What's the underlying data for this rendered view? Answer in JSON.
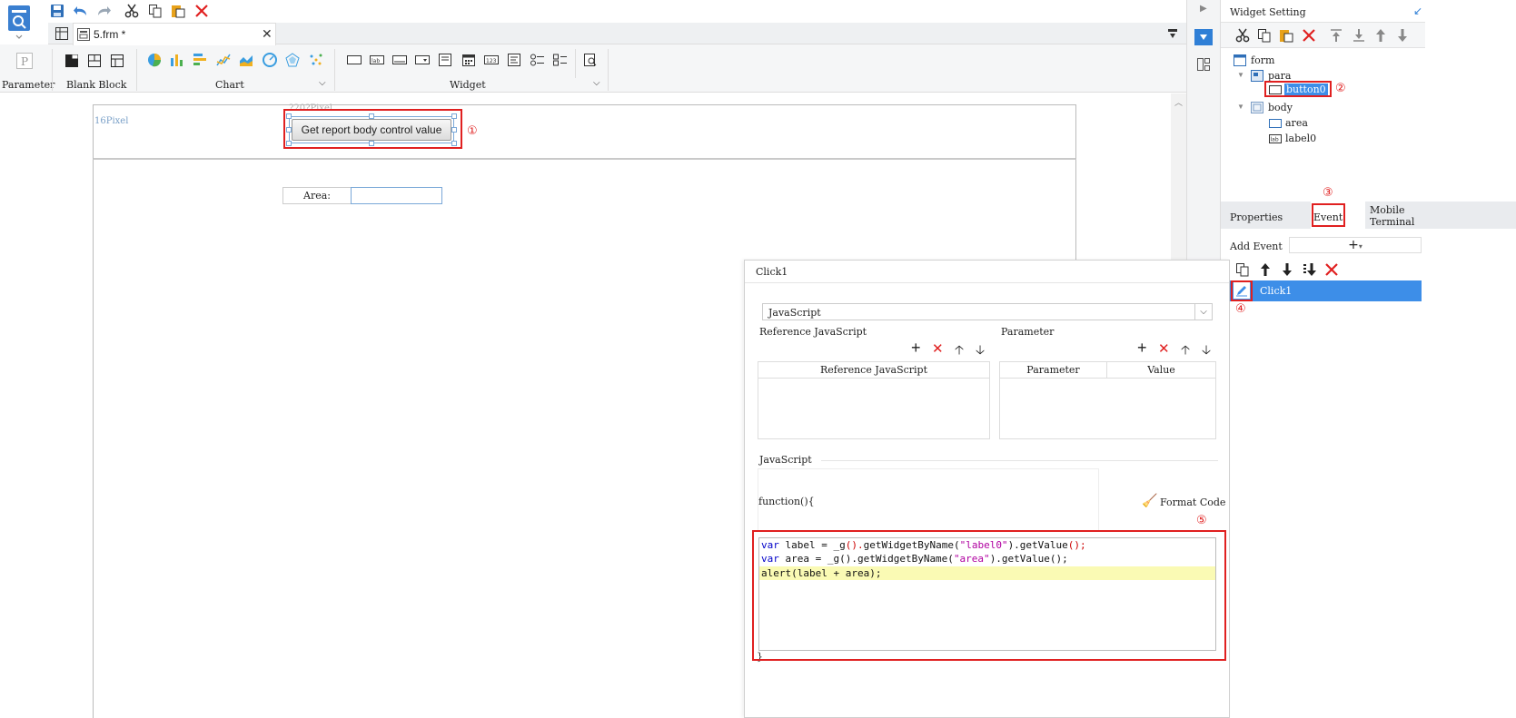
{
  "tab": {
    "filename": "5.frm *"
  },
  "ribbon": {
    "parameter_label": "Parameter",
    "blank_block_label": "Blank Block",
    "chart_label": "Chart",
    "widget_label": "Widget",
    "param_icon_letter": "P"
  },
  "canvas": {
    "ruler_left": "16Pixel",
    "ruler_top": "?20?Pixel",
    "button_text": "Get report body control value",
    "area_label": "Area:",
    "area_value": ""
  },
  "annotations": {
    "n1": "①",
    "n2": "②",
    "n3": "③",
    "n4": "④",
    "n5": "⑤"
  },
  "widget_setting": {
    "title": "Widget Setting",
    "tree": {
      "form": "form",
      "para": "para",
      "button0": "button0",
      "body": "body",
      "area": "area",
      "label0": "label0"
    },
    "tabs": {
      "properties": "Properties",
      "event": "Event",
      "mobile": "Mobile\nTerminal"
    },
    "add_event_label": "Add Event",
    "event_item": "Click1"
  },
  "dialog": {
    "title": "Click1",
    "type_value": "JavaScript",
    "ref_js_section": "Reference JavaScript",
    "param_section": "Parameter",
    "ref_js_col": "Reference JavaScript",
    "param_col": "Parameter",
    "value_col": "Value",
    "js_section": "JavaScript",
    "function_open": "function(){",
    "format_code": "Format Code",
    "code": {
      "l1_kw": "var",
      "l1_a": " label = _g",
      "l1_b": "().",
      "l1_c": "getWidgetByName(",
      "l1_str": "\"label0\"",
      "l1_d": ").getValue",
      "l1_e": "();",
      "l2_kw": "var",
      "l2_a": " area = _g().getWidgetByName(",
      "l2_str": "\"area\"",
      "l2_d": ").getValue();",
      "l3": "alert(label + area);"
    },
    "function_close": "}"
  },
  "colors": {
    "accent": "#2f7fd6",
    "annotation": "#e02020",
    "selection": "#3d8ee8"
  }
}
